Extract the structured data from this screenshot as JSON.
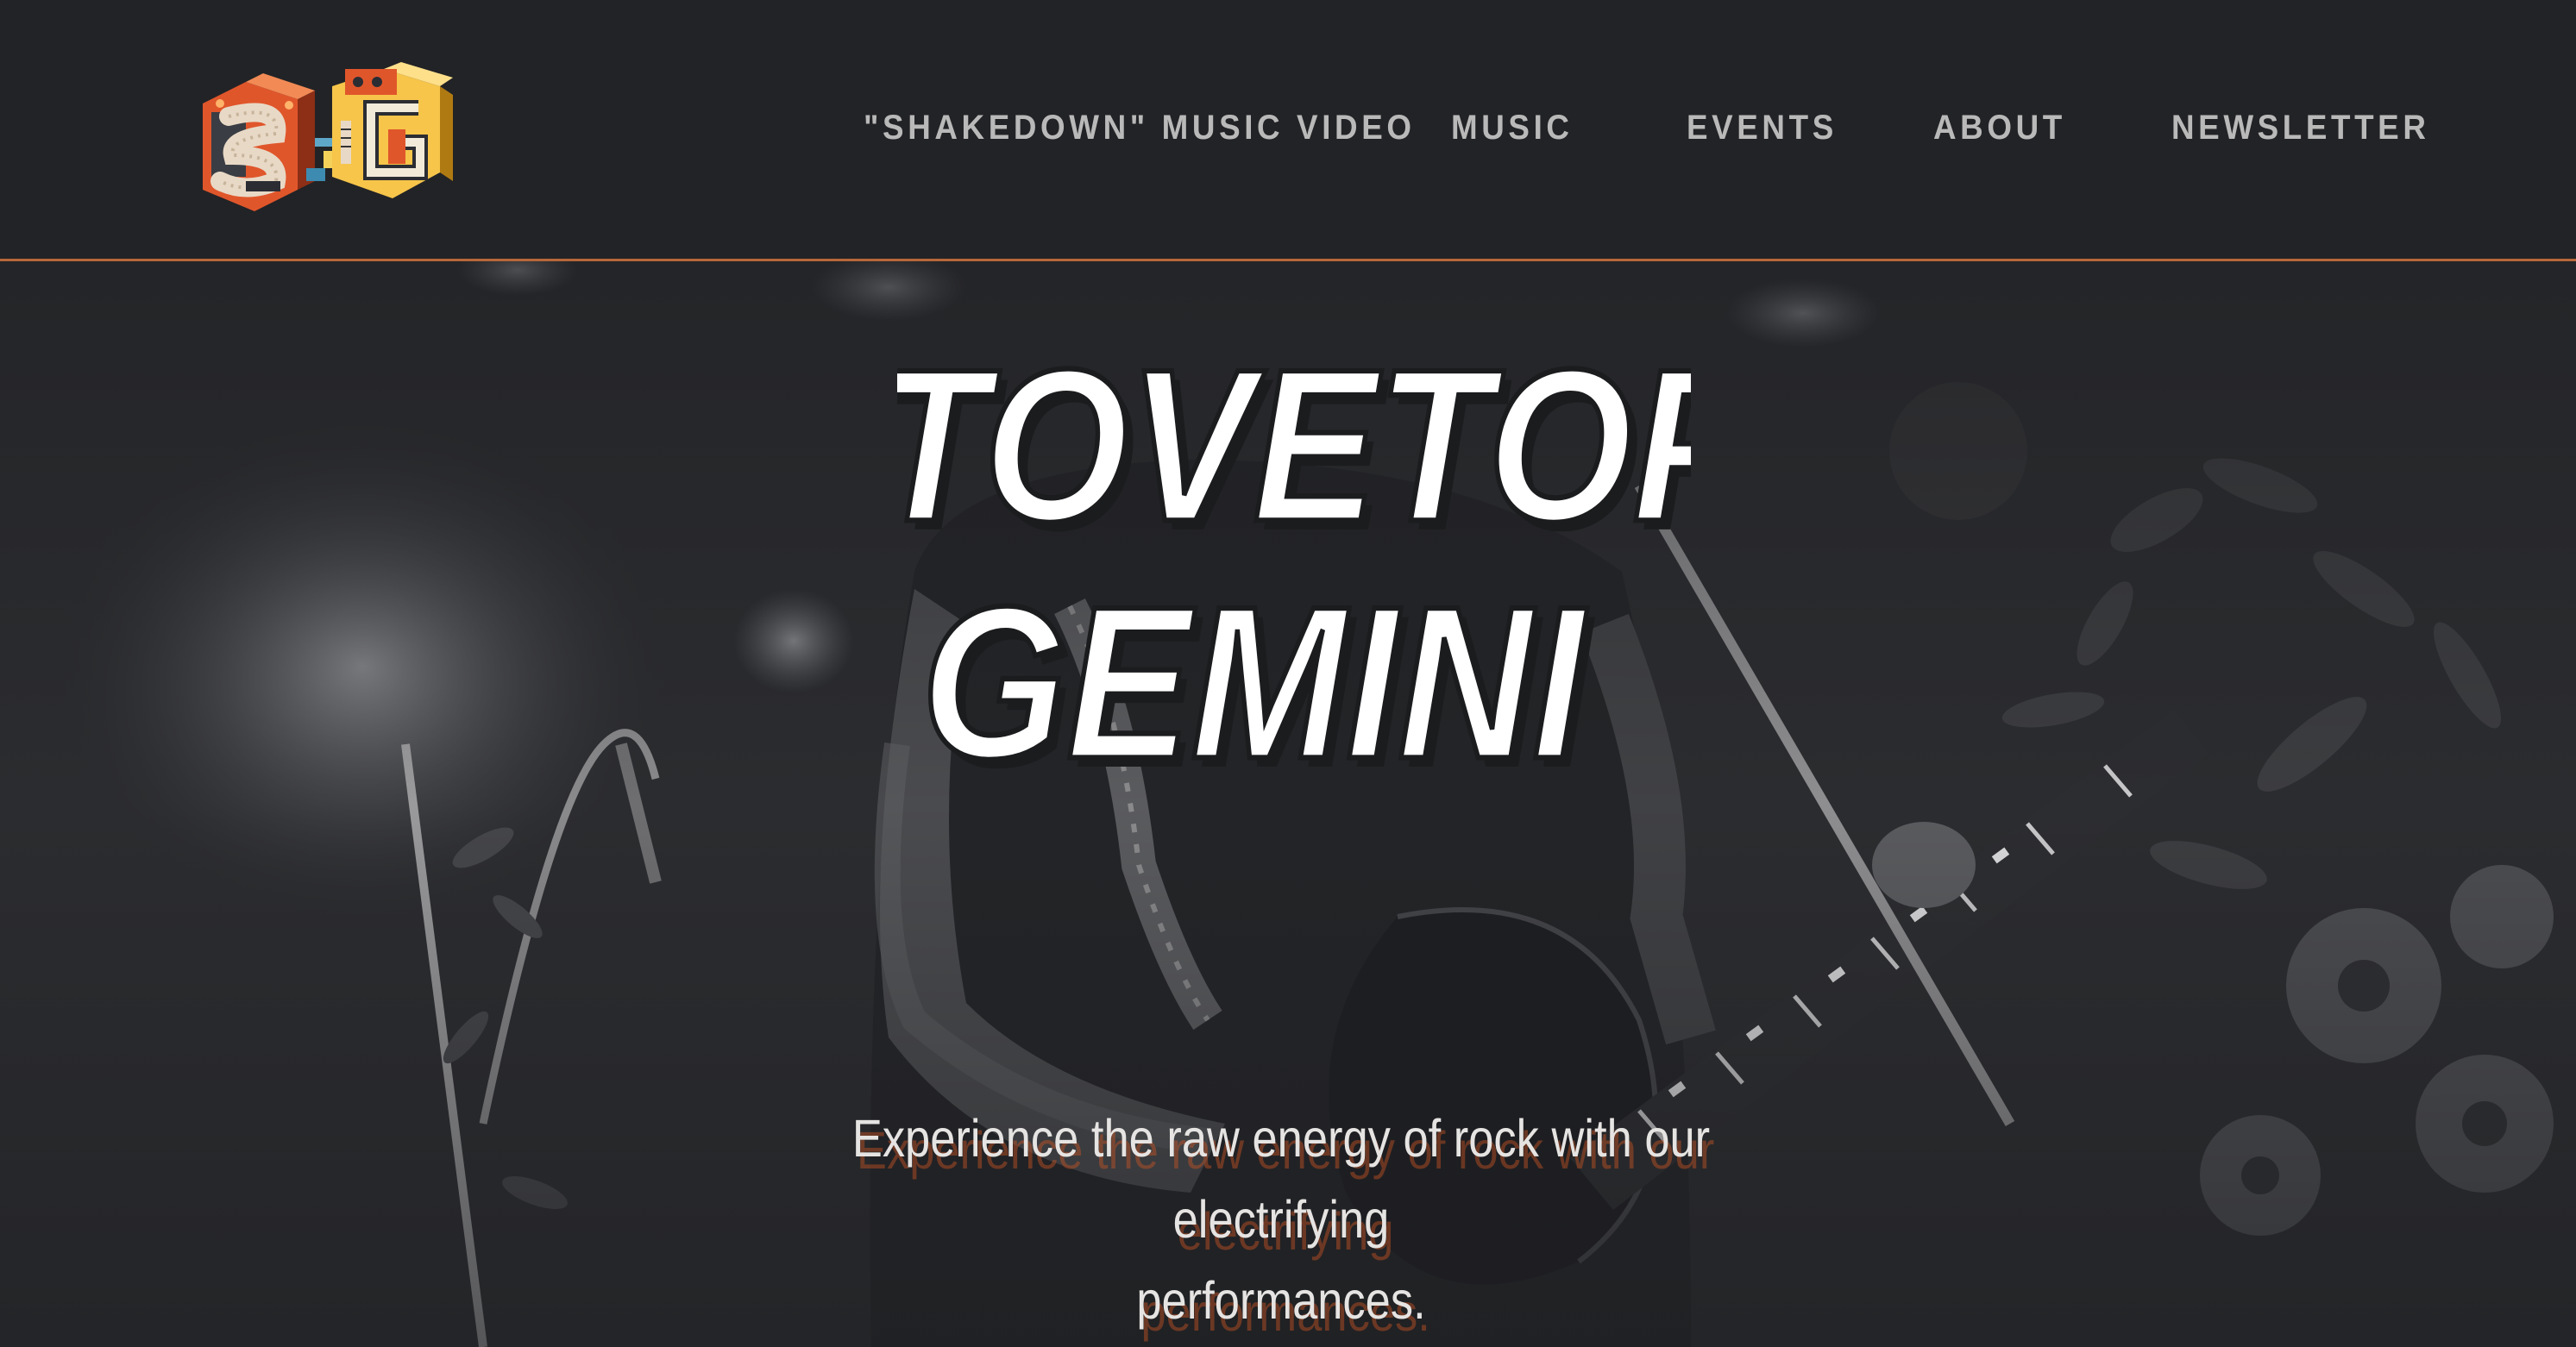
{
  "brand": {
    "logo_name": "SG logo",
    "accent_color": "#b8663a"
  },
  "nav": {
    "items": [
      {
        "label": "\"SHAKEDOWN\" MUSIC VIDEO"
      },
      {
        "label": "MUSIC"
      },
      {
        "label": "EVENTS"
      },
      {
        "label": "ABOUT"
      },
      {
        "label": "NEWSLETTER"
      }
    ]
  },
  "hero": {
    "title_line1": "STOVETOP",
    "title_line2": "GEMINI",
    "tagline_line1": "Experience the raw energy of rock with our electrifying",
    "tagline_line2": "performances."
  }
}
